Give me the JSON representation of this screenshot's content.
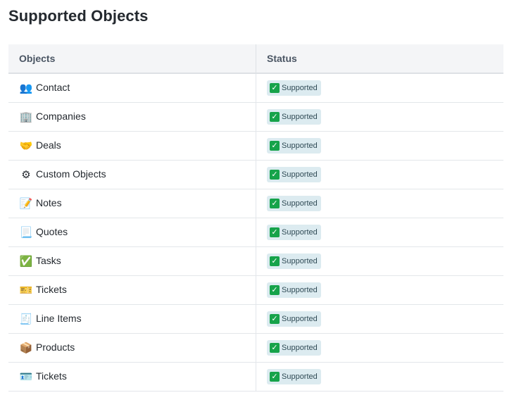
{
  "page": {
    "title": "Supported Objects"
  },
  "table": {
    "headers": [
      "Objects",
      "Status"
    ],
    "rows": [
      {
        "icon": "people-icon",
        "glyph": "👥",
        "label": "Contact",
        "status": "Supported"
      },
      {
        "icon": "office-building-icon",
        "glyph": "🏢",
        "label": "Companies",
        "status": "Supported"
      },
      {
        "icon": "handshake-icon",
        "glyph": "🤝",
        "label": "Deals",
        "status": "Supported"
      },
      {
        "icon": "gear-icon",
        "glyph": "⚙",
        "label": "Custom Objects",
        "status": "Supported"
      },
      {
        "icon": "memo-icon",
        "glyph": "📝",
        "label": "Notes",
        "status": "Supported"
      },
      {
        "icon": "newspaper-icon",
        "glyph": "📃",
        "label": "Quotes",
        "status": "Supported"
      },
      {
        "icon": "check-mark-icon",
        "glyph": "✅",
        "label": "Tasks",
        "status": "Supported"
      },
      {
        "icon": "ticket-icon",
        "glyph": "🎫",
        "label": "Tickets",
        "status": "Supported"
      },
      {
        "icon": "receipt-icon",
        "glyph": "🧾",
        "label": "Line Items",
        "status": "Supported"
      },
      {
        "icon": "package-icon",
        "glyph": "📦",
        "label": "Products",
        "status": "Supported"
      },
      {
        "icon": "id-card-icon",
        "glyph": "🪪",
        "label": "Tickets",
        "status": "Supported"
      }
    ]
  },
  "colors": {
    "badge_bg": "#dcebf0",
    "check_green": "#16a34a",
    "header_bg": "#f4f5f7"
  }
}
